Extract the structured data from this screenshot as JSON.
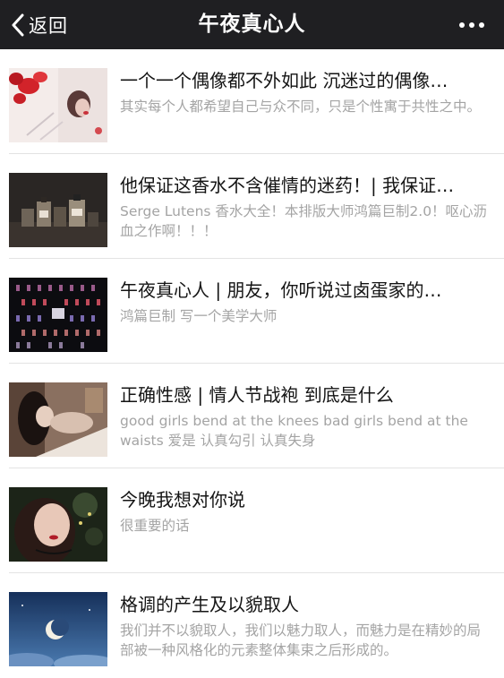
{
  "nav": {
    "back_label": "返回",
    "title": "午夜真心人"
  },
  "articles": [
    {
      "title": "一个一个偶像都不外如此 沉迷过的偶像…",
      "desc": "其实每个人都希望自己与众不同，只是个性寓于共性之中。"
    },
    {
      "title": "他保证这香水不含催情的迷药！| 我保证…",
      "desc": "Serge Lutens 香水大全！本排版大师鸿篇巨制2.0！呕心沥血之作啊！！！"
    },
    {
      "title": "午夜真心人 | 朋友，你听说过卤蛋家的…",
      "desc": "鸿篇巨制 写一个美学大师"
    },
    {
      "title": "正确性感 | 情人节战袍 到底是什么",
      "desc": "good girls bend at the knees bad girls bend at the waists 爱是 认真勾引 认真失身"
    },
    {
      "title": "今晚我想对你说",
      "desc": "很重要的话"
    },
    {
      "title": "格调的产生及以貌取人",
      "desc": "我们并不以貌取人，我们以魅力取人，而魅力是在精妙的局部被一种风格化的元素整体集束之后形成的。"
    }
  ]
}
